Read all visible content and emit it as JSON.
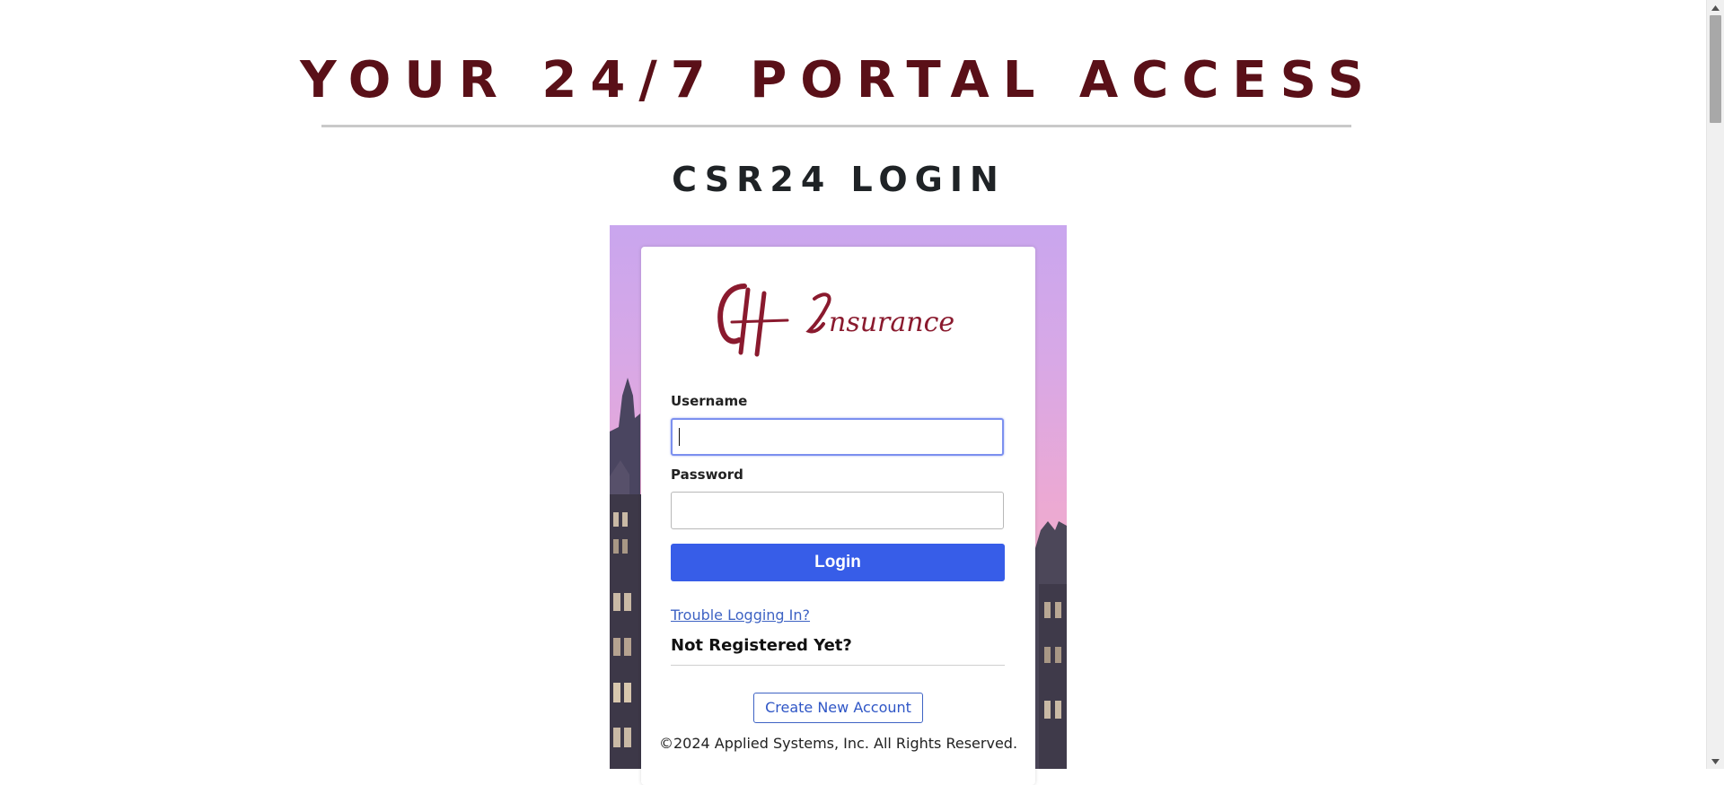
{
  "header": {
    "title": "YOUR 24/7 PORTAL ACCESS",
    "subtitle": "CSR24 LOGIN"
  },
  "login": {
    "logo_text": "CH Insurance",
    "username_label": "Username",
    "username_value": "",
    "password_label": "Password",
    "password_value": "",
    "login_button": "Login",
    "trouble_link": "Trouble Logging In?",
    "not_registered": "Not Registered Yet?",
    "create_account_button": "Create New Account",
    "copyright": "©2024 Applied Systems, Inc. All Rights Reserved."
  },
  "colors": {
    "heading": "#5a1018",
    "subheading": "#1f2326",
    "login_button": "#375de8",
    "link": "#3e63c4",
    "logo": "#8a1a2e"
  },
  "scrollbar": {
    "up_icon": "scroll-up-arrow-icon",
    "down_icon": "scroll-down-arrow-icon"
  }
}
